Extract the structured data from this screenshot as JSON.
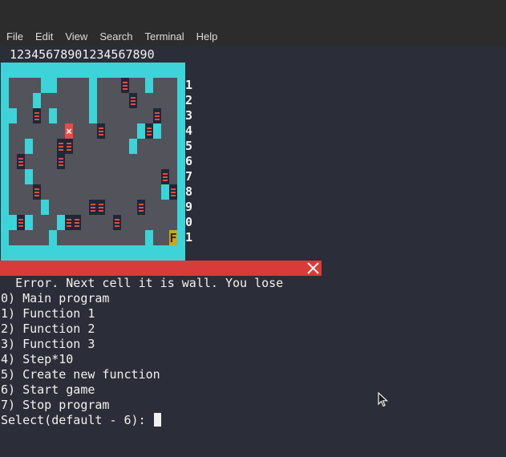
{
  "menu": [
    "File",
    "Edit",
    "View",
    "Search",
    "Terminal",
    "Help"
  ],
  "column_header": "12345678901234567890",
  "row_labels": [
    "1",
    "2",
    "3",
    "4",
    "5",
    "6",
    "7",
    "8",
    "9",
    "0",
    "1"
  ],
  "maze": {
    "rows": [
      "##############",
      "#.....##..#..#",
      "#...#.....#..#",
      "##..#.#......#",
      "#.......#..#.#",
      "#..#.......#.#",
      "#............#",
      "#..#.........#",
      "#...........##",
      "#....#.......#",
      "##.#..#......#",
      "#.....#....#.#",
      "##############"
    ],
    "boxes": [
      [
        1,
        15
      ],
      [
        2,
        16
      ],
      [
        3,
        4
      ],
      [
        3,
        19
      ],
      [
        4,
        12
      ],
      [
        4,
        18
      ],
      [
        5,
        7
      ],
      [
        5,
        8
      ],
      [
        6,
        2
      ],
      [
        6,
        7
      ],
      [
        7,
        20
      ],
      [
        8,
        4
      ],
      [
        8,
        21
      ],
      [
        9,
        11
      ],
      [
        9,
        12
      ],
      [
        9,
        17
      ],
      [
        10,
        2
      ],
      [
        10,
        8
      ],
      [
        10,
        9
      ],
      [
        10,
        14
      ]
    ],
    "player_x": [
      4,
      8
    ],
    "finish": [
      11,
      21
    ],
    "finish_label": "F",
    "player_glyph": "×",
    "colors": {
      "wall": "#3dd3d8",
      "floor": "#52535b",
      "box": "#232634",
      "stripe": "#e04d45",
      "player": "#e84a4a",
      "finish": "#c7a52a"
    }
  },
  "error_message": "Error. Next cell it is wall. You lose ",
  "menu_options": [
    "0) Main program",
    "1) Function 1",
    "2) Function 2",
    "3) Function 3",
    "4) Step*10",
    "5) Create new function",
    "6) Start game",
    "7) Stop program"
  ],
  "prompt": "Select(default - 6): "
}
